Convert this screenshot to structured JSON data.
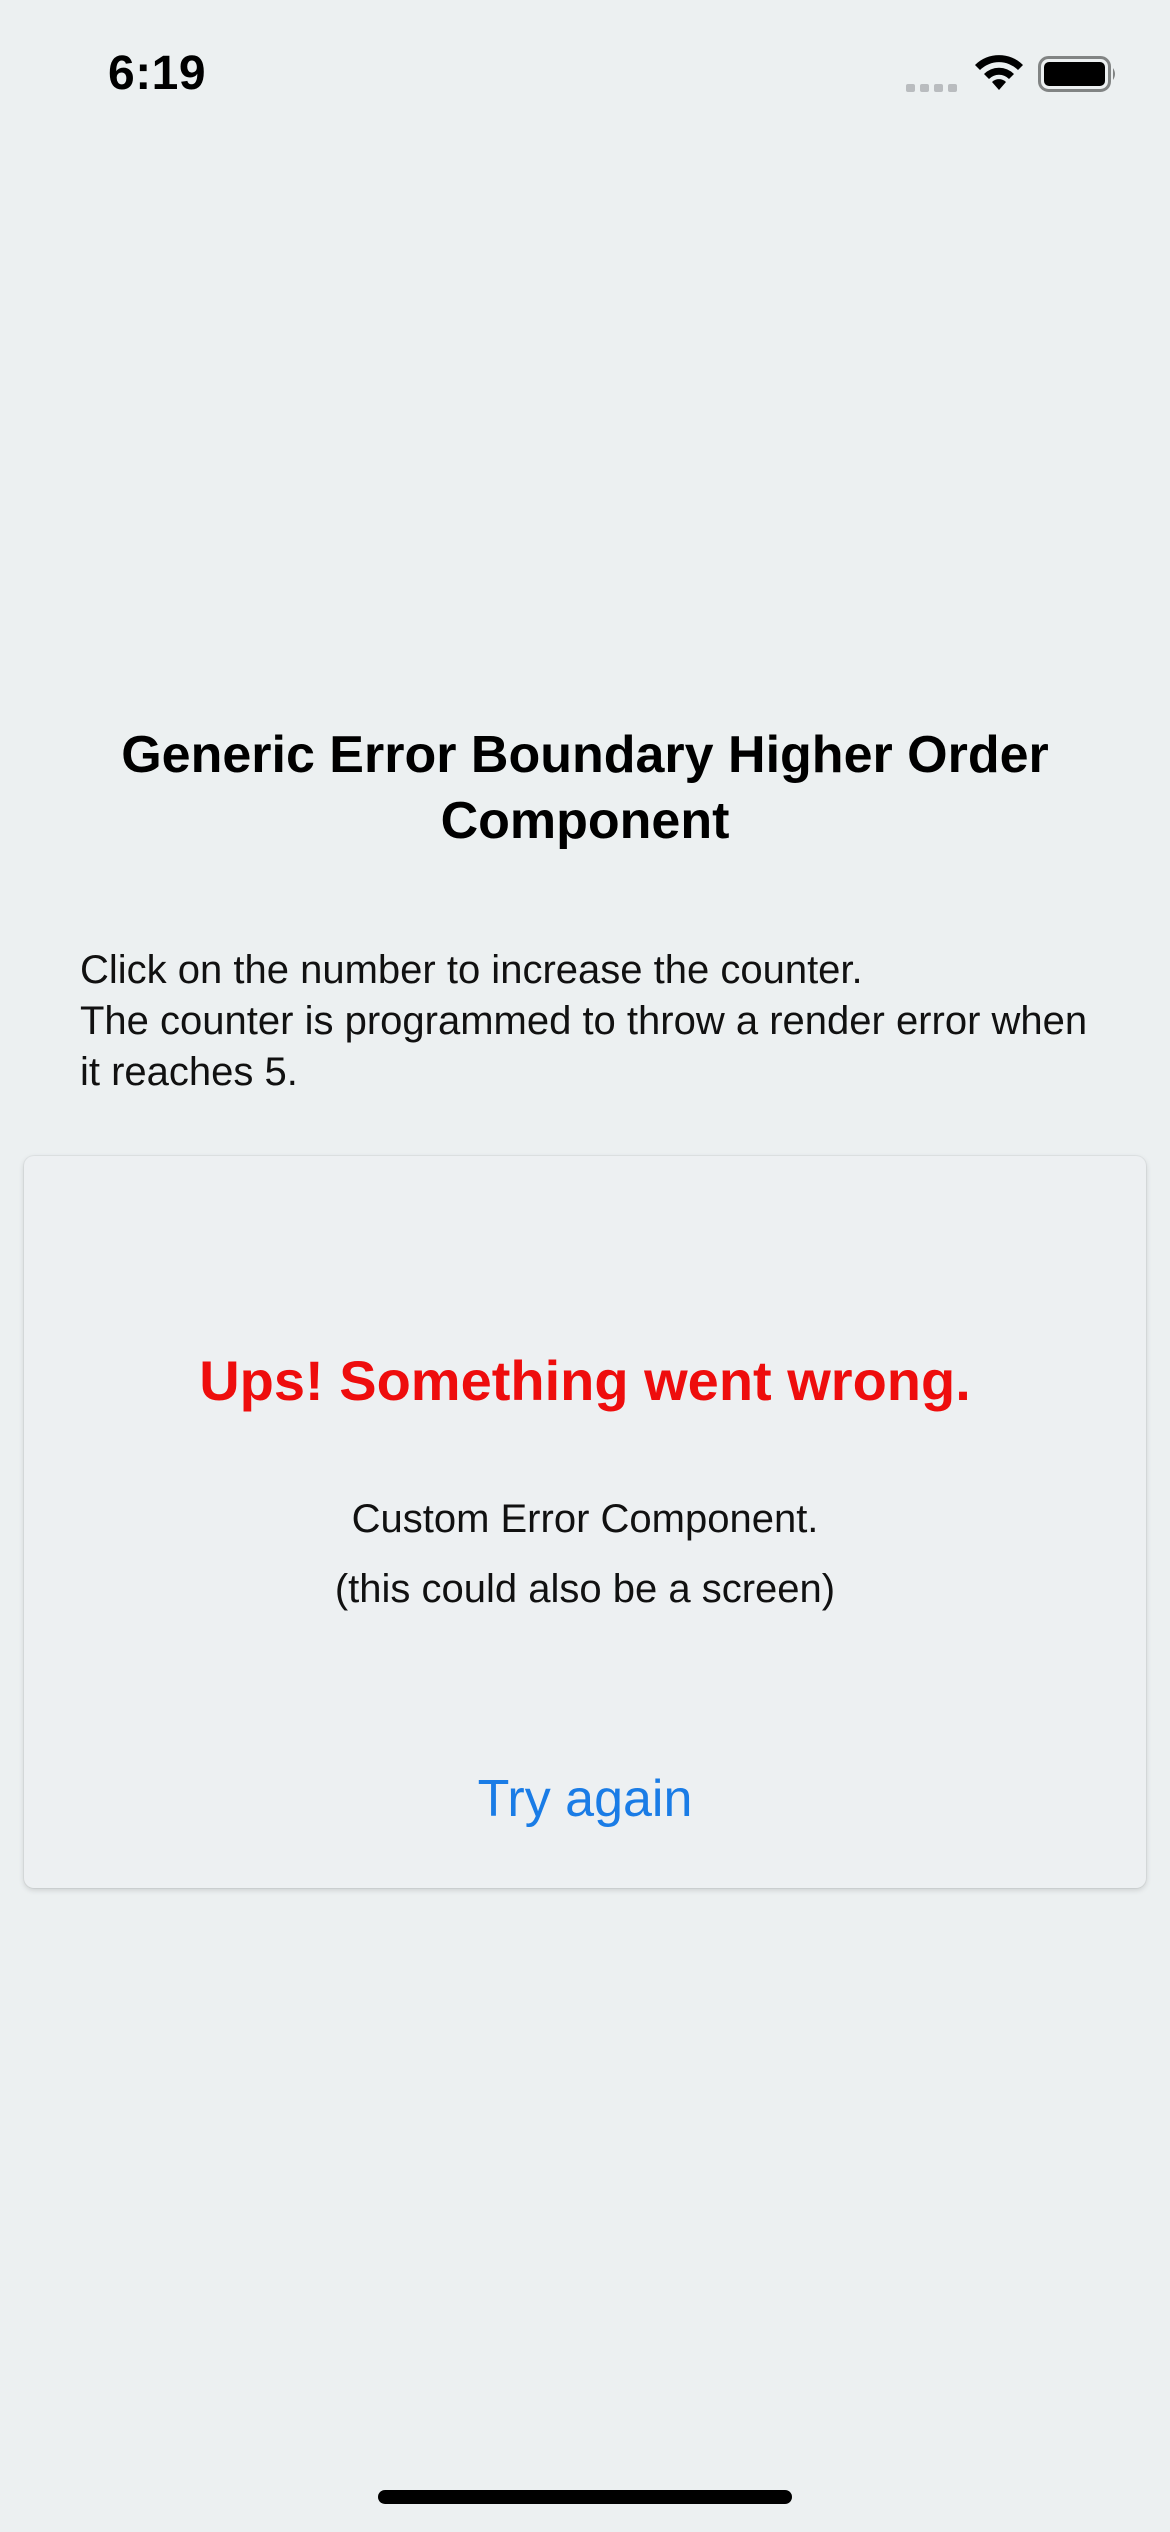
{
  "status_bar": {
    "time": "6:19",
    "icons": [
      "cellular-signal-icon",
      "wifi-icon",
      "battery-icon"
    ]
  },
  "title": "Generic Error Boundary Higher Order Component",
  "description": {
    "line1": "Click on the number to increase the counter.",
    "line2": "The counter is programmed to throw a render error when it reaches 5."
  },
  "error_card": {
    "title": "Ups! Something went wrong.",
    "subtitle_line1": "Custom Error Component.",
    "subtitle_line2": "(this could also be a screen)",
    "button_label": "Try again"
  },
  "colors": {
    "background": "#ecf0f1",
    "error_text": "#ee0d0d",
    "link": "#1a7ce6"
  }
}
